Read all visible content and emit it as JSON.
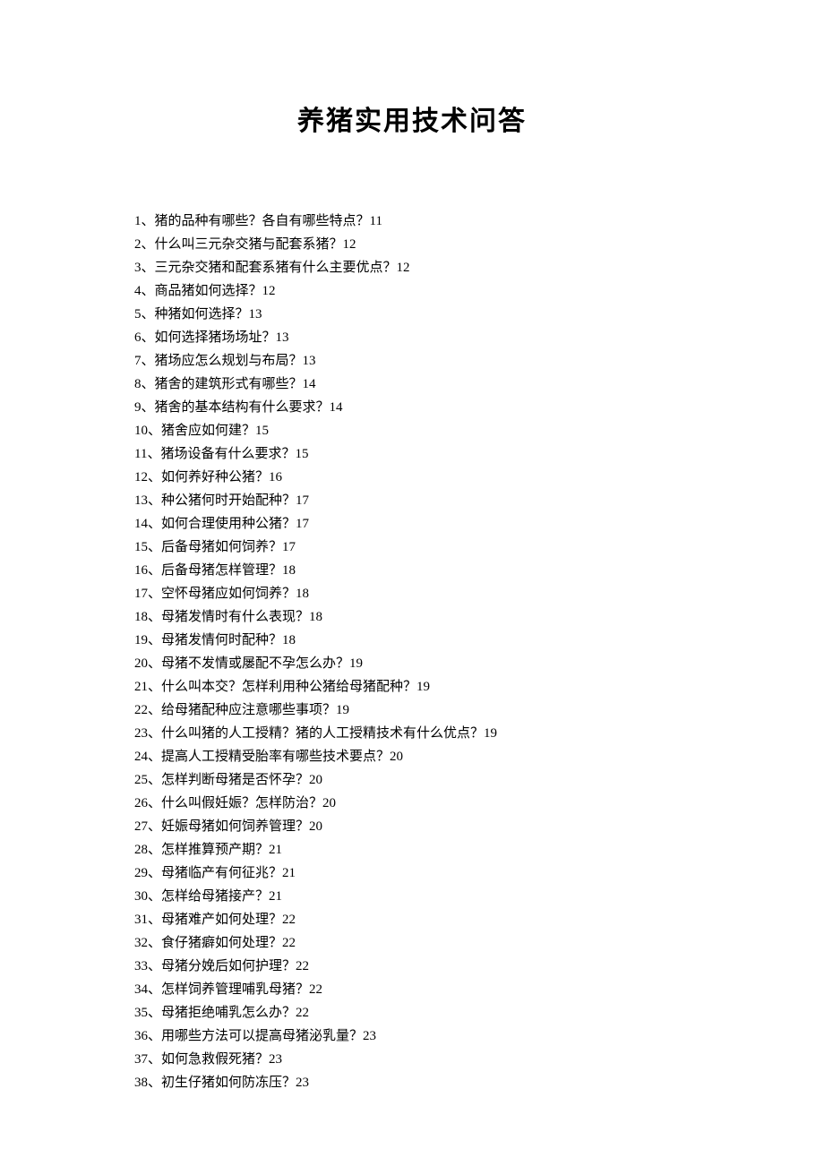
{
  "title": "养猪实用技术问答",
  "toc": [
    {
      "num": "1",
      "text": "猪的品种有哪些？各自有哪些特点？",
      "page": "11"
    },
    {
      "num": "2",
      "text": "什么叫三元杂交猪与配套系猪？",
      "page": "12"
    },
    {
      "num": "3",
      "text": "三元杂交猪和配套系猪有什么主要优点？",
      "page": "12"
    },
    {
      "num": "4",
      "text": "商品猪如何选择？",
      "page": "12"
    },
    {
      "num": "5",
      "text": "种猪如何选择？",
      "page": "13"
    },
    {
      "num": "6",
      "text": "如何选择猪场场址？",
      "page": "13"
    },
    {
      "num": "7",
      "text": "猪场应怎么规划与布局？",
      "page": "13"
    },
    {
      "num": "8",
      "text": "猪舍的建筑形式有哪些？",
      "page": "14"
    },
    {
      "num": "9",
      "text": "猪舍的基本结构有什么要求？",
      "page": "14"
    },
    {
      "num": "10",
      "text": "猪舍应如何建？",
      "page": "15"
    },
    {
      "num": "11",
      "text": "猪场设备有什么要求？",
      "page": "15"
    },
    {
      "num": "12",
      "text": "如何养好种公猪？",
      "page": "16"
    },
    {
      "num": "13",
      "text": "种公猪何时开始配种？",
      "page": "17"
    },
    {
      "num": "14",
      "text": "如何合理使用种公猪？",
      "page": "17"
    },
    {
      "num": "15",
      "text": "后备母猪如何饲养？",
      "page": "17"
    },
    {
      "num": "16",
      "text": "后备母猪怎样管理？",
      "page": "18"
    },
    {
      "num": "17",
      "text": "空怀母猪应如何饲养？",
      "page": "18"
    },
    {
      "num": "18",
      "text": "母猪发情时有什么表现？",
      "page": "18"
    },
    {
      "num": "19",
      "text": "母猪发情何时配种？",
      "page": "18"
    },
    {
      "num": "20",
      "text": "母猪不发情或屡配不孕怎么办？",
      "page": "19"
    },
    {
      "num": "21",
      "text": "什么叫本交？怎样利用种公猪给母猪配种？",
      "page": "19"
    },
    {
      "num": "22",
      "text": "给母猪配种应注意哪些事项？",
      "page": "19"
    },
    {
      "num": "23",
      "text": "什么叫猪的人工授精？猪的人工授精技术有什么优点？",
      "page": "19"
    },
    {
      "num": "24",
      "text": "提高人工授精受胎率有哪些技术要点？",
      "page": "20"
    },
    {
      "num": "25",
      "text": "怎样判断母猪是否怀孕？",
      "page": "20"
    },
    {
      "num": "26",
      "text": "什么叫假妊娠？怎样防治？",
      "page": "20"
    },
    {
      "num": "27",
      "text": "妊娠母猪如何饲养管理？",
      "page": "20"
    },
    {
      "num": "28",
      "text": "怎样推算预产期？",
      "page": "21"
    },
    {
      "num": "29",
      "text": "母猪临产有何征兆？",
      "page": "21"
    },
    {
      "num": "30",
      "text": "怎样给母猪接产？",
      "page": "21"
    },
    {
      "num": "31",
      "text": "母猪难产如何处理？",
      "page": "22"
    },
    {
      "num": "32",
      "text": "食仔猪癖如何处理？",
      "page": "22"
    },
    {
      "num": "33",
      "text": "母猪分娩后如何护理？",
      "page": "22"
    },
    {
      "num": "34",
      "text": "怎样饲养管理哺乳母猪？",
      "page": "22"
    },
    {
      "num": "35",
      "text": "母猪拒绝哺乳怎么办？",
      "page": "22"
    },
    {
      "num": "36",
      "text": "用哪些方法可以提高母猪泌乳量？",
      "page": "23"
    },
    {
      "num": "37",
      "text": "如何急救假死猪？",
      "page": "23"
    },
    {
      "num": "38",
      "text": "初生仔猪如何防冻压？",
      "page": "23"
    }
  ],
  "separator": "、"
}
